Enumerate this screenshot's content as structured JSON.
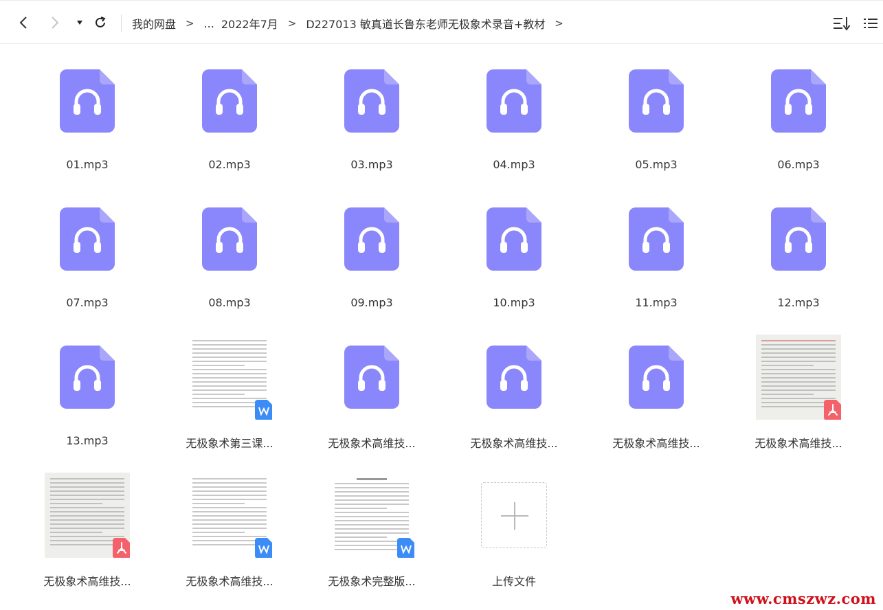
{
  "toolbar": {
    "back_icon": "chevron-left-icon",
    "forward_icon": "chevron-right-icon",
    "history_icon": "caret-down-icon",
    "refresh_icon": "refresh-icon",
    "sort_icon": "sort-icon",
    "view_icon": "list-view-icon"
  },
  "breadcrumb": {
    "items": [
      "我的网盘",
      "...",
      "2022年7月",
      "D227013 敏真道长鲁东老师无极象术录音+教材"
    ],
    "separator": ">"
  },
  "colors": {
    "audio_icon": "#8a86fb",
    "doc_badge": "#3b8cf7",
    "pdf_badge": "#f4616b",
    "watermark": "#d0101a"
  },
  "files": [
    {
      "name": "01.mp3",
      "type": "audio"
    },
    {
      "name": "02.mp3",
      "type": "audio"
    },
    {
      "name": "03.mp3",
      "type": "audio"
    },
    {
      "name": "04.mp3",
      "type": "audio"
    },
    {
      "name": "05.mp3",
      "type": "audio"
    },
    {
      "name": "06.mp3",
      "type": "audio"
    },
    {
      "name": "07.mp3",
      "type": "audio"
    },
    {
      "name": "08.mp3",
      "type": "audio"
    },
    {
      "name": "09.mp3",
      "type": "audio"
    },
    {
      "name": "10.mp3",
      "type": "audio"
    },
    {
      "name": "11.mp3",
      "type": "audio"
    },
    {
      "name": "12.mp3",
      "type": "audio"
    },
    {
      "name": "13.mp3",
      "type": "audio"
    },
    {
      "name": "无极象术第三课...",
      "type": "word"
    },
    {
      "name": "无极象术高维技...",
      "type": "audio"
    },
    {
      "name": "无极象术高维技...",
      "type": "audio"
    },
    {
      "name": "无极象术高维技...",
      "type": "audio"
    },
    {
      "name": "无极象术高维技...",
      "type": "pdf"
    },
    {
      "name": "无极象术高维技...",
      "type": "pdf"
    },
    {
      "name": "无极象术高维技...",
      "type": "word"
    },
    {
      "name": "无极象术完整版...",
      "type": "word"
    }
  ],
  "upload": {
    "label": "上传文件",
    "icon": "plus-icon"
  },
  "watermark": "www.cmszwz.com"
}
